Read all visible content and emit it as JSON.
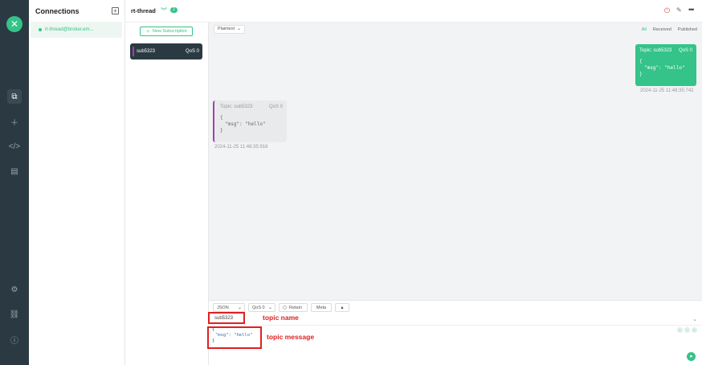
{
  "app": {
    "logo_glyph": "✕",
    "accent_color": "#34c388",
    "sidebar_bg": "#2b3a42"
  },
  "rail": {
    "icons": [
      "copy-icon",
      "plus-icon",
      "code-icon",
      "log-icon",
      "gear-icon",
      "subscribe-icon",
      "info-icon"
    ]
  },
  "connections": {
    "title": "Connections",
    "add_glyph": "+",
    "items": [
      {
        "label": "rt-thread@broker.em..."
      }
    ]
  },
  "subscriptions": {
    "new_label": "New Subscription",
    "items": [
      {
        "topic": "sub5323",
        "qos": "QoS 0",
        "color": "#a23fb3"
      }
    ]
  },
  "header": {
    "title": "rt-thread",
    "badge": "2"
  },
  "messages": {
    "format": "Plaintext",
    "filters": [
      "All",
      "Received",
      "Published"
    ],
    "active_filter": "All",
    "published": {
      "topic": "Topic: sub5323",
      "qos": "QoS 0",
      "body": [
        "{",
        "\"msg\": \"hello\"",
        "}"
      ],
      "time": "2024-11-25 11:48:35:742"
    },
    "received": {
      "topic": "Topic: sub5323",
      "qos": "QoS 0",
      "body": [
        "{",
        "\"msg\": \"hello\"",
        "}"
      ],
      "time": "2024-11-25 11:48:35:916"
    }
  },
  "composer": {
    "payload_type": "JSON",
    "qos": "QoS 0",
    "retain_label": "Retain",
    "meta_label": "Meta",
    "topic_value": "sub5323",
    "payload_lines": [
      "{",
      "\"msg\": \"hello\"",
      "}"
    ]
  },
  "annotations": {
    "topic_label": "topic name",
    "message_label": "topic message",
    "color": "#e02020"
  }
}
